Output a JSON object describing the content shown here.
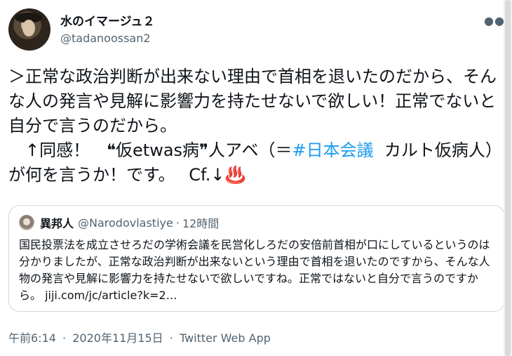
{
  "author": {
    "display_name": "水のイマージュ２",
    "handle": "@tadanoossan2"
  },
  "more_icon": "ellipsis-icon",
  "tweet": {
    "text_line1": "＞正常な政治判断が出来ない理由で首相を退いたのだから、そんな人の発言や見解に影響力を持たせないで欲しい！正常でないと自分で言うのだから。",
    "text_line2a": "　↑同感！　❝仮etwas病❞人アベ（＝",
    "hashtag": "#日本会議",
    "text_line2b": "  カルト仮病人）が何を言うか！です。　 Cf.↓",
    "emoji": "♨️",
    "emoji_name": "hot-springs-icon"
  },
  "quote": {
    "name": "異邦人",
    "handle": "@Narodovlastiye",
    "separator": "·",
    "time": "12時間",
    "text": "国民投票法を成立させろだの学術会議を民営化しろだの安倍前首相が口にしているというのは分かりましたが、正常な政治判断が出来ないという理由で首相を退いたのですから、そんな人物の発言や見解に影響力を持たせないで欲しいですね。正常ではないと自分で言うのですから。 jiji.com/jc/article?k=2…"
  },
  "meta": {
    "time": "午前6:14",
    "date": "2020年11月15日",
    "separator": "·",
    "source": "Twitter Web App"
  },
  "colors": {
    "hashtag": "#1d9bf0",
    "secondary_text": "#536471",
    "border": "#cfd9de"
  }
}
